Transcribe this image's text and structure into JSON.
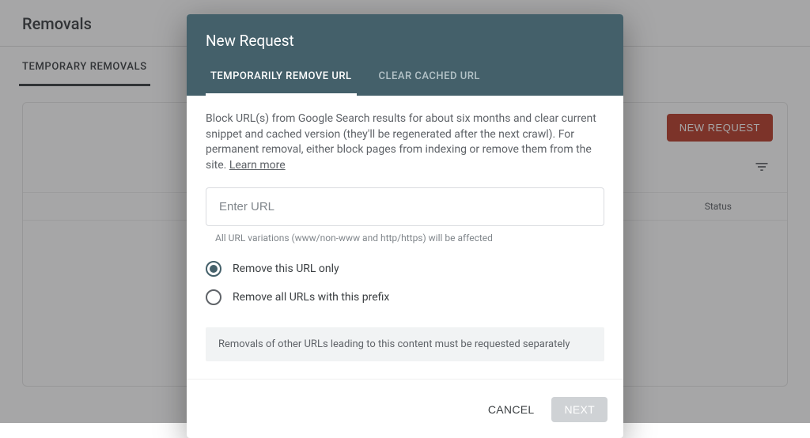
{
  "page": {
    "title": "Removals",
    "tab": "TEMPORARY REMOVALS",
    "new_request_btn": "NEW REQUEST",
    "status_header": "Status"
  },
  "dialog": {
    "title": "New Request",
    "tabs": {
      "remove": "TEMPORARILY REMOVE URL",
      "clear": "CLEAR CACHED URL"
    },
    "description": "Block URL(s) from Google Search results for about six months and clear current snippet and cached version (they'll be regenerated after the next crawl). For permanent removal, either block pages from indexing or remove them from the site. ",
    "learn_more": "Learn more",
    "input_placeholder": "Enter URL",
    "hint": "All URL variations (www/non-www and http/https) will be affected",
    "option_only": "Remove this URL only",
    "option_prefix": "Remove all URLs with this prefix",
    "notice": "Removals of other URLs leading to this content must be requested separately",
    "cancel": "CANCEL",
    "next": "NEXT"
  }
}
